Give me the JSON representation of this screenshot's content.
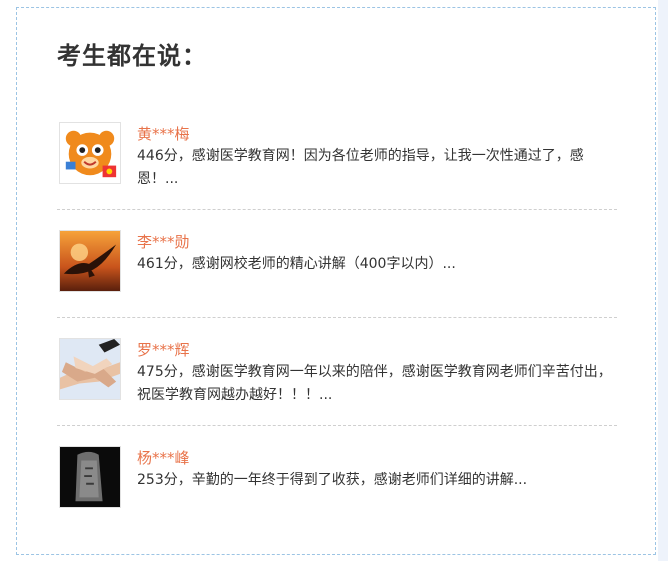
{
  "title": "考生都在说：",
  "testimonials": [
    {
      "name": "黄***梅",
      "comment": "446分，感谢医学教育网！因为各位老师的指导，让我一次性通过了，感恩！...",
      "avatar_icon": "cartoon-tiger-avatar-icon"
    },
    {
      "name": "李***勋",
      "comment": "461分，感谢网校老师的精心讲解（400字以内）...",
      "avatar_icon": "eagle-sunset-avatar-icon"
    },
    {
      "name": "罗***辉",
      "comment": "475分，感谢医学教育网一年以来的陪伴，感谢医学教育网老师们辛苦付出，祝医学教育网越办越好！！！...",
      "avatar_icon": "joined-hands-avatar-icon"
    },
    {
      "name": "杨***峰",
      "comment": "253分，辛勤的一年终于得到了收获，感谢老师们详细的讲解...",
      "avatar_icon": "dark-stone-avatar-icon"
    }
  ],
  "colors": {
    "name": "#e8734a",
    "border": "#9cc4e4",
    "text": "#333333"
  }
}
